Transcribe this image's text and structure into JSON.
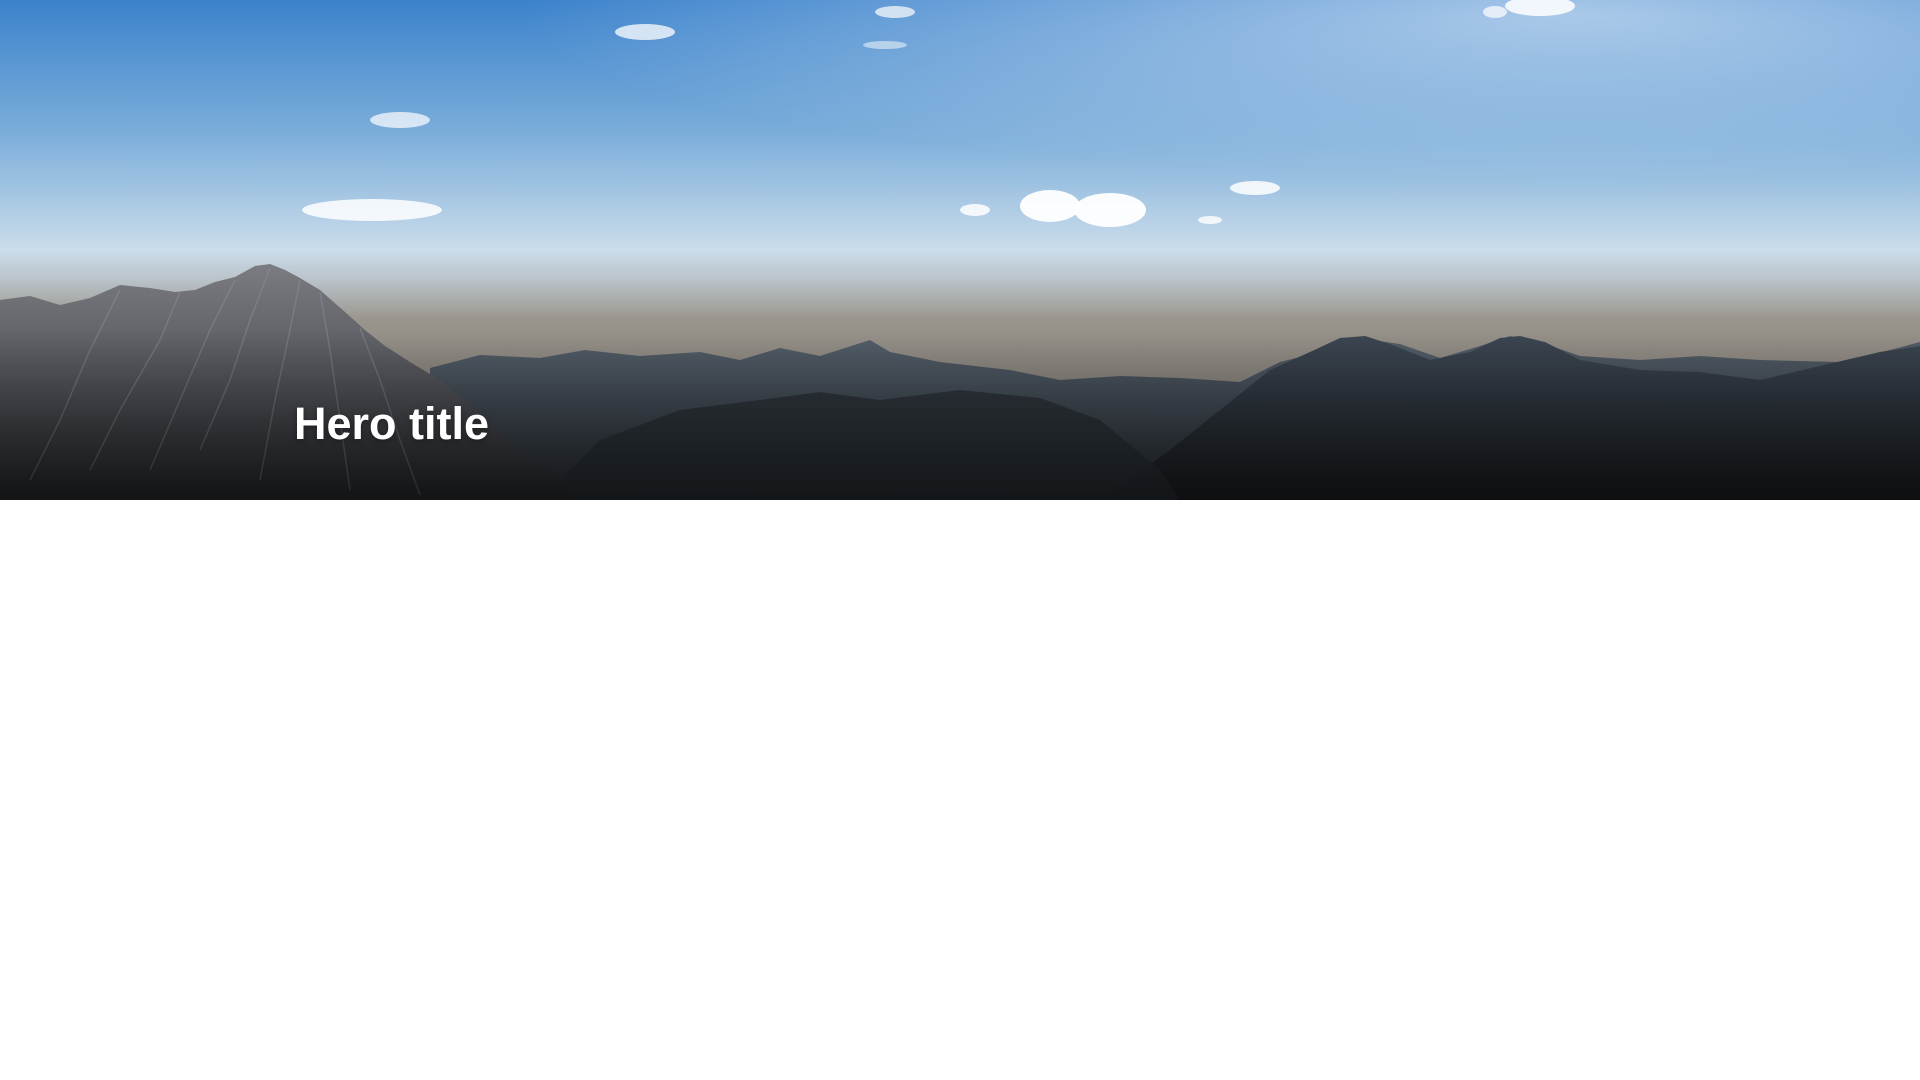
{
  "hero": {
    "title": "Hero title",
    "image": "mountain-landscape-photo",
    "colors": {
      "sky_top": "#3d86cf",
      "sky_horizon": "#cfe0ee",
      "haze": "#8a8a86",
      "mountain_dark": "#23282e",
      "title_text": "#ffffff"
    }
  },
  "page": {
    "background": "#ffffff"
  }
}
